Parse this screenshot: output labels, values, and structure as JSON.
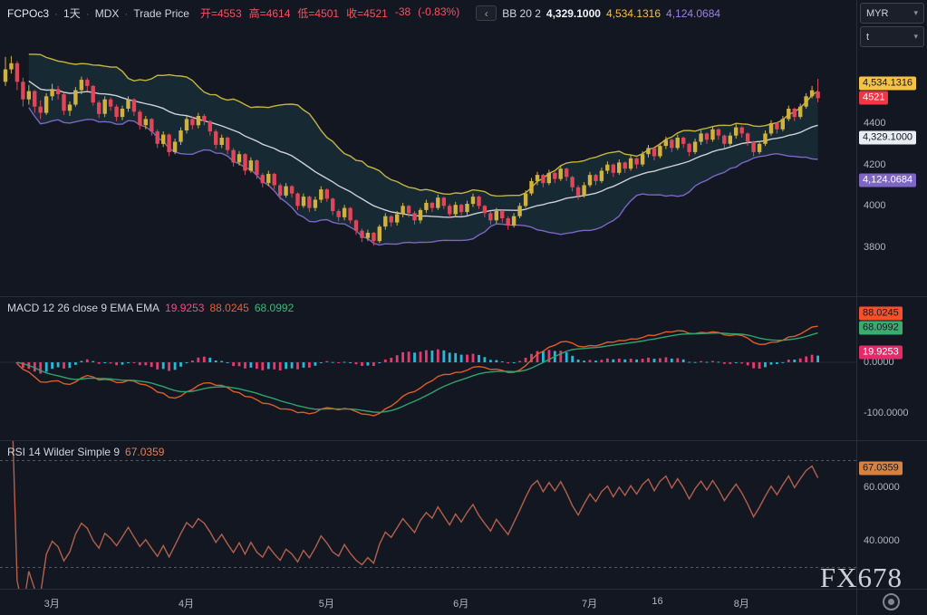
{
  "header": {
    "symbol": "FCPOc3",
    "interval": "1天",
    "exchange": "MDX",
    "price_type": "Trade Price",
    "separator": "·",
    "collapse_glyph": "‹",
    "ohlc": [
      "开=4553",
      "高=4614",
      "低=4501",
      "收=4521",
      "-38",
      "(-0.83%)"
    ]
  },
  "indicators": {
    "bb": {
      "label": "BB 20 2",
      "basis": "4,329.1000",
      "upper": "4,534.1316",
      "lower": "4,124.0684"
    },
    "macd": {
      "label": "MACD 12 26 close 9 EMA EMA",
      "hist": "19.9253",
      "macd": "88.0245",
      "signal": "68.0992"
    },
    "rsi": {
      "label": "RSI 14 Wilder Simple 9",
      "value": "67.0359"
    }
  },
  "toolbar": {
    "currency": "MYR",
    "unit": "t"
  },
  "watermark": "FX678",
  "price_axis": {
    "ticks": [
      {
        "label": "4400",
        "price": 4400
      },
      {
        "label": "4200",
        "price": 4200
      },
      {
        "label": "4000",
        "price": 4000
      },
      {
        "label": "3800",
        "price": 3800
      }
    ],
    "badges": [
      {
        "name": "bb-upper-badge",
        "label": "4,534.1316",
        "price": 4534.1316,
        "bg": "#f5c242",
        "fg": "#131722"
      },
      {
        "name": "last-price-badge",
        "label": "4521",
        "price": 4521,
        "bg": "#f23645",
        "fg": "#ffffff"
      },
      {
        "name": "bb-basis-badge",
        "label": "4,329.1000",
        "price": 4329.1,
        "bg": "#e9ecf2",
        "fg": "#131722"
      },
      {
        "name": "bb-lower-badge",
        "label": "4,124.0684",
        "price": 4124.0684,
        "bg": "#7e66c4",
        "fg": "#ffffff"
      }
    ]
  },
  "macd_axis": {
    "ticks": [
      {
        "label": "0.0000",
        "value": 0
      },
      {
        "label": "-100.0000",
        "value": -100
      }
    ],
    "badges": [
      {
        "name": "macd-line-badge",
        "label": "88.0245",
        "value": 88.0245,
        "bg": "#f4502a",
        "fg": "#131722"
      },
      {
        "name": "macd-signal-badge",
        "label": "68.0992",
        "value": 68.0992,
        "bg": "#3cab6e",
        "fg": "#131722"
      },
      {
        "name": "macd-hist-badge",
        "label": "19.9253",
        "value": 19.9253,
        "bg": "#e52a6a",
        "fg": "#ffffff"
      }
    ]
  },
  "rsi_axis": {
    "ticks": [
      {
        "label": "60.0000",
        "value": 60
      },
      {
        "label": "40.0000",
        "value": 40
      }
    ],
    "badges": [
      {
        "name": "rsi-value-badge",
        "label": "67.0359",
        "value": 67.0359,
        "bg": "#d9823f",
        "fg": "#131722"
      }
    ]
  },
  "time_axis": {
    "items": [
      {
        "label": "3月",
        "index": 8
      },
      {
        "label": "4月",
        "index": 31
      },
      {
        "label": "5月",
        "index": 55
      },
      {
        "label": "6月",
        "index": 78
      },
      {
        "label": "7月",
        "index": 100
      },
      {
        "label": "16",
        "index": 112
      },
      {
        "label": "8月",
        "index": 126
      }
    ]
  },
  "colors": {
    "background": "#131722",
    "divider": "#2a2e39",
    "axis_text": "#b2b5be",
    "candle_up": "#d1b23e",
    "candle_down": "#e0465a",
    "bb_upper": "#c5b43e",
    "bb_basis": "#cdd0d8",
    "bb_lower": "#7e66c4",
    "bb_fill": "rgba(42,130,125,0.18)",
    "macd_line": "#df5c28",
    "macd_signal": "#2fa36e",
    "hist_grow": "#e33a6f",
    "hist_fall": "#29b8d8",
    "rsi_line": "#b3604a",
    "level_dash": "#56585f"
  },
  "chart_data": {
    "type": "candlestick",
    "title": "FCPOc3 1天 MDX Trade Price",
    "x_ticks": [
      "3月",
      "4月",
      "5月",
      "6月",
      "7月",
      "16",
      "8月"
    ],
    "ylim": [
      3560,
      4995
    ],
    "y_ticks": [
      4400,
      4200,
      4000,
      3800
    ],
    "last_bar": {
      "open": 4553,
      "high": 4614,
      "low": 4501,
      "close": 4521,
      "change": -38,
      "change_pct": -0.83
    },
    "indicator_settings": {
      "bollinger": {
        "period": 20,
        "stddev": 2,
        "basis": 4329.1,
        "upper": 4534.1316,
        "lower": 4124.0684
      },
      "macd": {
        "fast": 12,
        "slow": 26,
        "source": "close",
        "signal_period": 9,
        "macd": 88.0245,
        "signal": 68.0992,
        "histogram": 19.9253,
        "axis_ticks": [
          0,
          -100
        ]
      },
      "rsi": {
        "period": 14,
        "smoothing": "Wilder Simple 9",
        "value": 67.0359,
        "upper_band": 70,
        "lower_band": 30,
        "axis_ticks": [
          60,
          40
        ]
      }
    },
    "candles": [
      [
        4600,
        4720,
        4580,
        4660
      ],
      [
        4660,
        4725,
        4640,
        4690
      ],
      [
        4690,
        4700,
        4560,
        4600
      ],
      [
        4600,
        4620,
        4480,
        4515
      ],
      [
        4515,
        4585,
        4490,
        4555
      ],
      [
        4555,
        4560,
        4450,
        4480
      ],
      [
        4480,
        4510,
        4420,
        4450
      ],
      [
        4450,
        4545,
        4440,
        4530
      ],
      [
        4530,
        4590,
        4510,
        4565
      ],
      [
        4565,
        4580,
        4515,
        4540
      ],
      [
        4540,
        4545,
        4440,
        4460
      ],
      [
        4460,
        4505,
        4435,
        4490
      ],
      [
        4490,
        4575,
        4480,
        4560
      ],
      [
        4560,
        4625,
        4540,
        4610
      ],
      [
        4610,
        4620,
        4555,
        4580
      ],
      [
        4580,
        4585,
        4485,
        4500
      ],
      [
        4500,
        4510,
        4425,
        4445
      ],
      [
        4445,
        4530,
        4430,
        4515
      ],
      [
        4515,
        4525,
        4460,
        4480
      ],
      [
        4480,
        4490,
        4410,
        4430
      ],
      [
        4430,
        4485,
        4415,
        4470
      ],
      [
        4470,
        4530,
        4455,
        4515
      ],
      [
        4515,
        4520,
        4435,
        4455
      ],
      [
        4455,
        4465,
        4370,
        4390
      ],
      [
        4390,
        4435,
        4370,
        4420
      ],
      [
        4420,
        4425,
        4340,
        4360
      ],
      [
        4360,
        4370,
        4280,
        4300
      ],
      [
        4300,
        4360,
        4285,
        4345
      ],
      [
        4345,
        4350,
        4240,
        4260
      ],
      [
        4260,
        4325,
        4250,
        4310
      ],
      [
        4310,
        4380,
        4295,
        4365
      ],
      [
        4365,
        4435,
        4350,
        4420
      ],
      [
        4420,
        4430,
        4370,
        4390
      ],
      [
        4390,
        4450,
        4375,
        4435
      ],
      [
        4435,
        4445,
        4390,
        4410
      ],
      [
        4410,
        4415,
        4340,
        4360
      ],
      [
        4360,
        4370,
        4275,
        4295
      ],
      [
        4295,
        4345,
        4280,
        4330
      ],
      [
        4330,
        4335,
        4250,
        4270
      ],
      [
        4270,
        4280,
        4190,
        4210
      ],
      [
        4210,
        4265,
        4195,
        4250
      ],
      [
        4250,
        4255,
        4150,
        4170
      ],
      [
        4170,
        4235,
        4160,
        4220
      ],
      [
        4220,
        4225,
        4130,
        4150
      ],
      [
        4150,
        4160,
        4090,
        4110
      ],
      [
        4110,
        4170,
        4095,
        4155
      ],
      [
        4155,
        4160,
        4080,
        4100
      ],
      [
        4100,
        4110,
        4030,
        4050
      ],
      [
        4050,
        4110,
        4040,
        4095
      ],
      [
        4095,
        4100,
        4040,
        4060
      ],
      [
        4060,
        4065,
        3980,
        4000
      ],
      [
        4000,
        4060,
        3990,
        4045
      ],
      [
        4045,
        4050,
        3970,
        3990
      ],
      [
        3990,
        4045,
        3975,
        4030
      ],
      [
        4030,
        4095,
        4015,
        4080
      ],
      [
        4080,
        4085,
        4020,
        4035
      ],
      [
        4035,
        4040,
        3955,
        3975
      ],
      [
        3975,
        3985,
        3925,
        3945
      ],
      [
        3945,
        4005,
        3930,
        3990
      ],
      [
        3990,
        3995,
        3915,
        3930
      ],
      [
        3930,
        3935,
        3860,
        3880
      ],
      [
        3880,
        3890,
        3825,
        3845
      ],
      [
        3845,
        3885,
        3830,
        3870
      ],
      [
        3870,
        3875,
        3808,
        3830
      ],
      [
        3830,
        3910,
        3820,
        3900
      ],
      [
        3900,
        3965,
        3885,
        3950
      ],
      [
        3950,
        3955,
        3900,
        3920
      ],
      [
        3920,
        3975,
        3905,
        3960
      ],
      [
        3960,
        4015,
        3945,
        4000
      ],
      [
        4000,
        4005,
        3945,
        3965
      ],
      [
        3965,
        3975,
        3910,
        3930
      ],
      [
        3930,
        3990,
        3915,
        3980
      ],
      [
        3980,
        4030,
        3965,
        4015
      ],
      [
        4015,
        4020,
        3970,
        3990
      ],
      [
        3990,
        4055,
        3980,
        4040
      ],
      [
        4040,
        4045,
        3985,
        4000
      ],
      [
        4000,
        4010,
        3940,
        3960
      ],
      [
        3960,
        4020,
        3945,
        4005
      ],
      [
        4005,
        4010,
        3950,
        3970
      ],
      [
        3970,
        4025,
        3955,
        4010
      ],
      [
        4010,
        4060,
        3995,
        4045
      ],
      [
        4045,
        4050,
        3985,
        4000
      ],
      [
        4000,
        4005,
        3945,
        3965
      ],
      [
        3965,
        3975,
        3910,
        3930
      ],
      [
        3930,
        3990,
        3915,
        3975
      ],
      [
        3975,
        3980,
        3920,
        3940
      ],
      [
        3940,
        3950,
        3885,
        3905
      ],
      [
        3905,
        3965,
        3895,
        3950
      ],
      [
        3950,
        4015,
        3940,
        4000
      ],
      [
        4000,
        4075,
        3990,
        4060
      ],
      [
        4060,
        4135,
        4050,
        4120
      ],
      [
        4120,
        4165,
        4100,
        4150
      ],
      [
        4150,
        4155,
        4090,
        4110
      ],
      [
        4110,
        4175,
        4100,
        4160
      ],
      [
        4160,
        4165,
        4110,
        4130
      ],
      [
        4130,
        4195,
        4120,
        4180
      ],
      [
        4180,
        4185,
        4120,
        4140
      ],
      [
        4140,
        4145,
        4070,
        4090
      ],
      [
        4090,
        4100,
        4030,
        4050
      ],
      [
        4050,
        4115,
        4040,
        4100
      ],
      [
        4100,
        4165,
        4090,
        4150
      ],
      [
        4150,
        4155,
        4100,
        4120
      ],
      [
        4120,
        4185,
        4110,
        4170
      ],
      [
        4170,
        4215,
        4155,
        4200
      ],
      [
        4200,
        4205,
        4140,
        4160
      ],
      [
        4160,
        4225,
        4150,
        4210
      ],
      [
        4210,
        4215,
        4160,
        4180
      ],
      [
        4180,
        4245,
        4170,
        4230
      ],
      [
        4230,
        4235,
        4180,
        4200
      ],
      [
        4200,
        4265,
        4190,
        4250
      ],
      [
        4250,
        4295,
        4235,
        4280
      ],
      [
        4280,
        4285,
        4220,
        4240
      ],
      [
        4240,
        4305,
        4230,
        4290
      ],
      [
        4290,
        4335,
        4275,
        4320
      ],
      [
        4320,
        4325,
        4260,
        4280
      ],
      [
        4280,
        4345,
        4270,
        4330
      ],
      [
        4330,
        4335,
        4280,
        4300
      ],
      [
        4300,
        4305,
        4240,
        4260
      ],
      [
        4260,
        4325,
        4250,
        4310
      ],
      [
        4310,
        4365,
        4295,
        4350
      ],
      [
        4350,
        4355,
        4300,
        4320
      ],
      [
        4320,
        4385,
        4310,
        4370
      ],
      [
        4370,
        4375,
        4320,
        4340
      ],
      [
        4340,
        4345,
        4280,
        4300
      ],
      [
        4300,
        4355,
        4290,
        4340
      ],
      [
        4340,
        4395,
        4325,
        4380
      ],
      [
        4380,
        4385,
        4330,
        4350
      ],
      [
        4350,
        4355,
        4290,
        4310
      ],
      [
        4310,
        4315,
        4240,
        4260
      ],
      [
        4260,
        4315,
        4250,
        4300
      ],
      [
        4300,
        4365,
        4290,
        4350
      ],
      [
        4350,
        4415,
        4340,
        4400
      ],
      [
        4400,
        4405,
        4350,
        4370
      ],
      [
        4370,
        4435,
        4360,
        4420
      ],
      [
        4420,
        4485,
        4410,
        4470
      ],
      [
        4470,
        4475,
        4410,
        4430
      ],
      [
        4430,
        4495,
        4420,
        4480
      ],
      [
        4480,
        4545,
        4470,
        4530
      ],
      [
        4530,
        4580,
        4520,
        4559
      ],
      [
        4553,
        4614,
        4501,
        4521
      ]
    ]
  }
}
